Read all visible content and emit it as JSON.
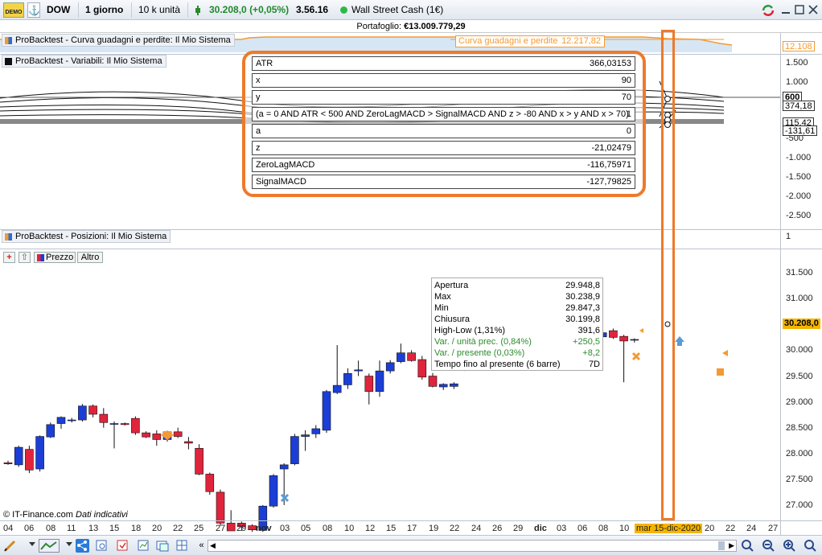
{
  "toolbar": {
    "demo_badge": "DEMO",
    "instrument": "DOW",
    "timeframe": "1 giorno",
    "units": "10 k unità",
    "price": "30.208,0",
    "change": "(+0,05%)",
    "time": "3.56.16",
    "market_name": "Wall Street Cash (1€)"
  },
  "portfolio": {
    "label": "Portafoglio:",
    "value": "€13.009.779,29"
  },
  "equity_panel": {
    "label": "ProBacktest - Curva guadagni e perdite: Il Mio Sistema",
    "curve_caption": "Curva guadagni e perdite",
    "curve_value": "12.217,82",
    "scale_tag": "12.108"
  },
  "variables_panel": {
    "label": "ProBacktest - Variabili: Il Mio Sistema",
    "rows": [
      {
        "name": "ATR",
        "value": "366,03153"
      },
      {
        "name": "x",
        "value": "90"
      },
      {
        "name": "y",
        "value": "70"
      },
      {
        "name": "(a = 0 AND ATR < 500 AND ZeroLagMACD > SignalMACD AND z > -80 AND x > y AND x > 70)",
        "value": "1"
      },
      {
        "name": "a",
        "value": "0"
      },
      {
        "name": "z",
        "value": "-21,02479"
      },
      {
        "name": "ZeroLagMACD",
        "value": "-116,75971"
      },
      {
        "name": "SignalMACD",
        "value": "-127,79825"
      }
    ],
    "y_labels": [
      "1.500",
      "1.000",
      "500",
      "-500",
      "-1.000",
      "-1.500",
      "-2.000",
      "-2.500"
    ],
    "tags": [
      "600",
      "374,18",
      "115,42",
      "-131,61"
    ]
  },
  "positions_panel": {
    "label": "ProBacktest - Posizioni: Il Mio Sistema",
    "scale_value": "1"
  },
  "price_panel": {
    "tab_price": "Prezzo",
    "tab_other": "Altro",
    "y_labels": [
      "31.500",
      "31.000",
      "30.500",
      "30.000",
      "29.500",
      "29.000",
      "28.500",
      "28.000",
      "27.500",
      "27.000"
    ],
    "last_price": "30.208,0",
    "copyright": "© IT-Finance.com",
    "disclaimer": "Dati indicativi"
  },
  "tooltip": {
    "rows": [
      {
        "label": "Apertura",
        "value": "29.948,8",
        "green": false
      },
      {
        "label": "Max",
        "value": "30.238,9",
        "green": false
      },
      {
        "label": "Min",
        "value": "29.847,3",
        "green": false
      },
      {
        "label": "Chiusura",
        "value": "30.199,8",
        "green": false
      },
      {
        "label": "High-Low  (1,31%)",
        "value": "391,6",
        "green": false
      },
      {
        "label": "Var. / unità prec. (0,84%)",
        "value": "+250,5",
        "green": true
      },
      {
        "label": "Var. / presente  (0,03%)",
        "value": "+8,2",
        "green": true
      },
      {
        "label": "Tempo fino al presente (6 barre)",
        "value": "7D",
        "green": false
      }
    ]
  },
  "x_axis": {
    "labels": [
      "04",
      "06",
      "08",
      "11",
      "13",
      "15",
      "18",
      "20",
      "22",
      "25",
      "27",
      "29",
      "nov",
      "03",
      "05",
      "08",
      "10",
      "12",
      "15",
      "17",
      "19",
      "22",
      "24",
      "26",
      "29",
      "dic",
      "03",
      "06",
      "08",
      "10",
      "mar 15-dic-2020",
      "20",
      "22",
      "24",
      "27"
    ]
  },
  "chart_data": {
    "type": "candlestick",
    "series_name": "DOW",
    "ylim": [
      26500,
      31800
    ],
    "candles": [
      {
        "o": 27820,
        "h": 27860,
        "l": 27780,
        "c": 27800
      },
      {
        "o": 27780,
        "h": 28150,
        "l": 27740,
        "c": 28120
      },
      {
        "o": 28080,
        "h": 28150,
        "l": 27620,
        "c": 27680
      },
      {
        "o": 27700,
        "h": 28350,
        "l": 27650,
        "c": 28330
      },
      {
        "o": 28320,
        "h": 28600,
        "l": 28300,
        "c": 28560
      },
      {
        "o": 28580,
        "h": 28720,
        "l": 28480,
        "c": 28700
      },
      {
        "o": 28650,
        "h": 28690,
        "l": 28600,
        "c": 28650
      },
      {
        "o": 28650,
        "h": 28960,
        "l": 28620,
        "c": 28920
      },
      {
        "o": 28920,
        "h": 28950,
        "l": 28700,
        "c": 28760
      },
      {
        "o": 28760,
        "h": 28880,
        "l": 28500,
        "c": 28600
      },
      {
        "o": 28580,
        "h": 28620,
        "l": 28100,
        "c": 28580
      },
      {
        "o": 28580,
        "h": 28600,
        "l": 28540,
        "c": 28560
      },
      {
        "o": 28680,
        "h": 28720,
        "l": 28360,
        "c": 28400
      },
      {
        "o": 28400,
        "h": 28430,
        "l": 28300,
        "c": 28320
      },
      {
        "o": 28380,
        "h": 28450,
        "l": 28150,
        "c": 28270
      },
      {
        "o": 28270,
        "h": 28440,
        "l": 28230,
        "c": 28420
      },
      {
        "o": 28420,
        "h": 28500,
        "l": 28300,
        "c": 28330
      },
      {
        "o": 28230,
        "h": 28320,
        "l": 28080,
        "c": 28200
      },
      {
        "o": 28100,
        "h": 28180,
        "l": 27580,
        "c": 27600
      },
      {
        "o": 27600,
        "h": 27630,
        "l": 27200,
        "c": 27260
      },
      {
        "o": 27250,
        "h": 27300,
        "l": 26600,
        "c": 26650
      },
      {
        "o": 26650,
        "h": 26900,
        "l": 26500,
        "c": 26500
      },
      {
        "o": 26650,
        "h": 26680,
        "l": 26500,
        "c": 26580
      },
      {
        "o": 26600,
        "h": 26630,
        "l": 26480,
        "c": 26520
      },
      {
        "o": 26510,
        "h": 27000,
        "l": 26480,
        "c": 26980
      },
      {
        "o": 26980,
        "h": 27600,
        "l": 26950,
        "c": 27570
      },
      {
        "o": 27700,
        "h": 27810,
        "l": 27000,
        "c": 27780
      },
      {
        "o": 27800,
        "h": 28380,
        "l": 27770,
        "c": 28330
      },
      {
        "o": 28330,
        "h": 28450,
        "l": 28050,
        "c": 28360
      },
      {
        "o": 28380,
        "h": 28550,
        "l": 28300,
        "c": 28480
      },
      {
        "o": 28450,
        "h": 29230,
        "l": 28400,
        "c": 29200
      },
      {
        "o": 29180,
        "h": 30100,
        "l": 29150,
        "c": 29320
      },
      {
        "o": 29330,
        "h": 29650,
        "l": 29250,
        "c": 29550
      },
      {
        "o": 29600,
        "h": 29800,
        "l": 29500,
        "c": 29620
      },
      {
        "o": 29500,
        "h": 29550,
        "l": 28950,
        "c": 29200
      },
      {
        "o": 29200,
        "h": 29800,
        "l": 29100,
        "c": 29600
      },
      {
        "o": 29600,
        "h": 29810,
        "l": 29550,
        "c": 29760
      },
      {
        "o": 29780,
        "h": 30130,
        "l": 29750,
        "c": 29950
      },
      {
        "o": 29950,
        "h": 30000,
        "l": 29780,
        "c": 29800
      },
      {
        "o": 29820,
        "h": 29890,
        "l": 29430,
        "c": 29480
      },
      {
        "o": 29500,
        "h": 29560,
        "l": 29280,
        "c": 29300
      },
      {
        "o": 29290,
        "h": 29360,
        "l": 29230,
        "c": 29340
      },
      {
        "o": 29300,
        "h": 29380,
        "l": 29250,
        "c": 29350
      },
      {
        "o": 29650,
        "h": 29720,
        "l": 29600,
        "c": 29700
      },
      {
        "o": 29780,
        "h": 29840,
        "l": 29700,
        "c": 29810
      },
      {
        "o": 29870,
        "h": 30010,
        "l": 29840,
        "c": 29920
      },
      {
        "o": 29950,
        "h": 30020,
        "l": 29900,
        "c": 30000
      },
      {
        "o": 30000,
        "h": 30200,
        "l": 29940,
        "c": 30150
      },
      {
        "o": 30210,
        "h": 30260,
        "l": 29960,
        "c": 30000
      },
      {
        "o": 30200,
        "h": 30260,
        "l": 30050,
        "c": 30090
      },
      {
        "o": 30060,
        "h": 30120,
        "l": 29940,
        "c": 30000
      },
      {
        "o": 30100,
        "h": 30150,
        "l": 30020,
        "c": 30050
      },
      {
        "o": 30150,
        "h": 30250,
        "l": 29850,
        "c": 29900
      },
      {
        "o": 29950,
        "h": 30240,
        "l": 29850,
        "c": 30200
      },
      {
        "o": 30200,
        "h": 30300,
        "l": 30100,
        "c": 30150
      },
      {
        "o": 30150,
        "h": 30280,
        "l": 30120,
        "c": 30260
      },
      {
        "o": 30260,
        "h": 30380,
        "l": 30220,
        "c": 30340
      },
      {
        "o": 30380,
        "h": 30420,
        "l": 30220,
        "c": 30250
      },
      {
        "o": 30270,
        "h": 30300,
        "l": 29380,
        "c": 30180
      },
      {
        "o": 30200,
        "h": 30230,
        "l": 30150,
        "c": 30210
      }
    ]
  },
  "colors": {
    "up": "#1b3fd6",
    "down": "#e0243b",
    "highlight": "#ee7a2a",
    "equity_line": "#f39a33"
  }
}
